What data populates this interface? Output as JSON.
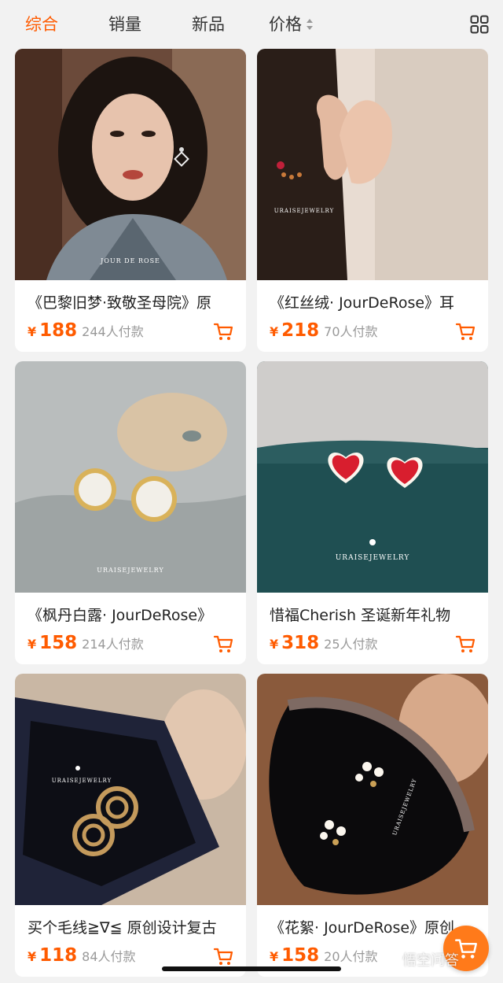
{
  "tabs": [
    {
      "label": "综合",
      "active": true
    },
    {
      "label": "销量",
      "active": false
    },
    {
      "label": "新品",
      "active": false
    },
    {
      "label": "价格",
      "active": false
    }
  ],
  "accent_color": "#ff5b00",
  "currency": "¥",
  "products": [
    {
      "title": "《巴黎旧梦·致敬圣母院》原",
      "price": "188",
      "sold": "244人付款",
      "image_brand": "JOUR DE ROSE"
    },
    {
      "title": "《红丝绒· JourDeRose》耳",
      "price": "218",
      "sold": "70人付款",
      "image_brand": "URAISEJEWELRY"
    },
    {
      "title": "《枫丹白露· JourDeRose》",
      "price": "158",
      "sold": "214人付款",
      "image_brand": "URAISEJEWELRY"
    },
    {
      "title": "惜福Cherish 圣诞新年礼物",
      "price": "318",
      "sold": "25人付款",
      "image_brand": "URAISEJEWELRY"
    },
    {
      "title": "买个毛线≧∇≦ 原创设计复古",
      "price": "118",
      "sold": "84人付款",
      "image_brand": "URAISEJEWELRY"
    },
    {
      "title": "《花絮· JourDeRose》原创",
      "price": "158",
      "sold": "20人付款",
      "image_brand": "URAISEJEWELRY"
    }
  ],
  "watermark": "悟空问答",
  "icons": {
    "grid_toggle": "grid-view-icon",
    "cart": "cart-icon",
    "sort": "sort-arrows-icon",
    "fab": "cart-icon"
  }
}
